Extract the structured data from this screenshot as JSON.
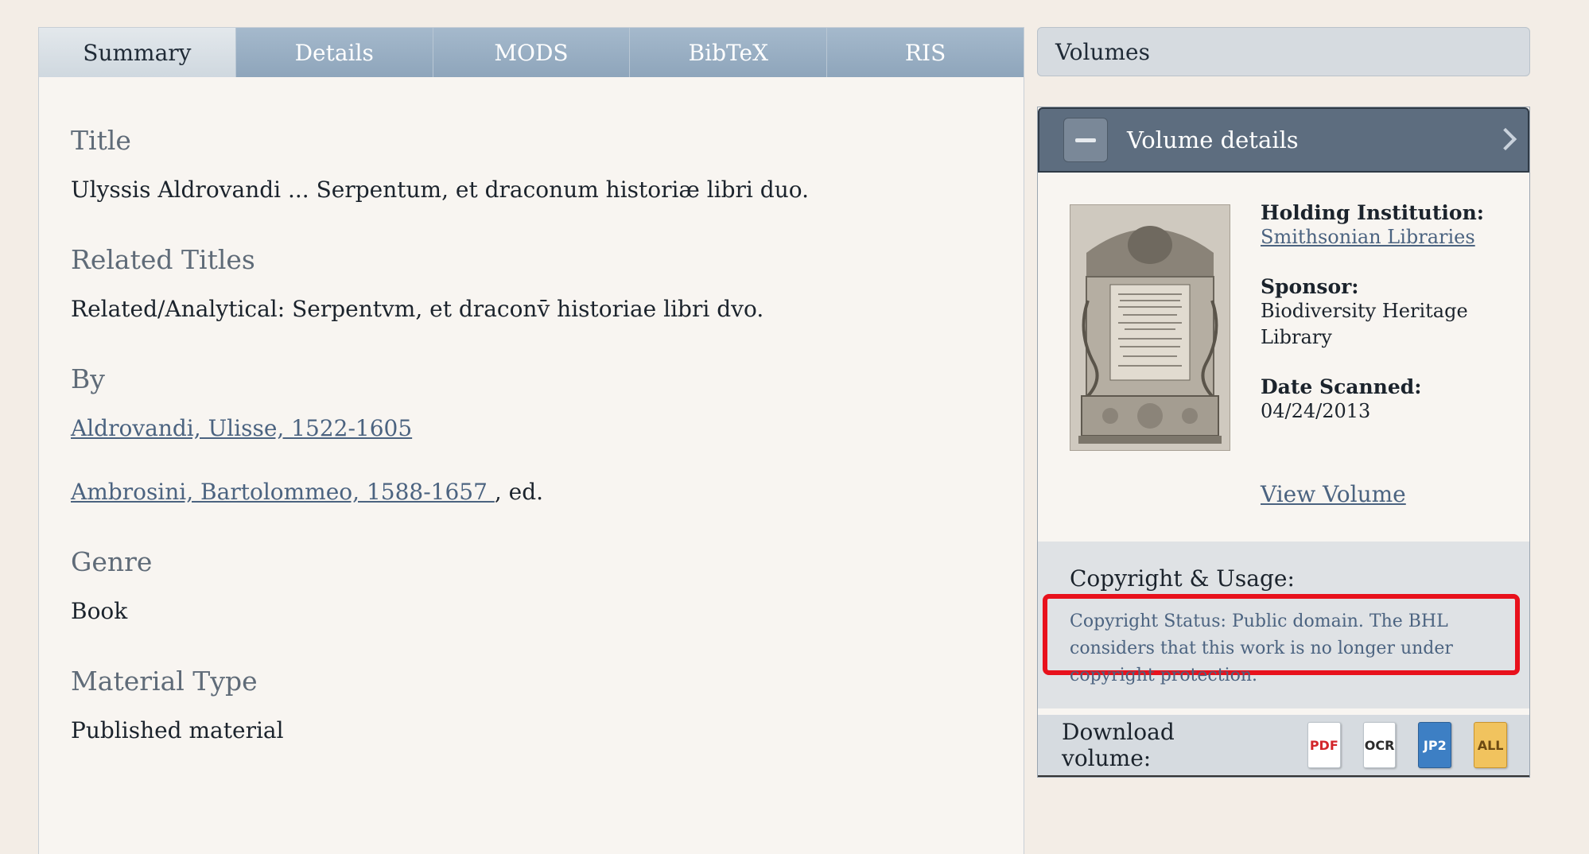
{
  "tabs": [
    {
      "label": "Summary",
      "active": true
    },
    {
      "label": "Details",
      "active": false
    },
    {
      "label": "MODS",
      "active": false
    },
    {
      "label": "BibTeX",
      "active": false
    },
    {
      "label": "RIS",
      "active": false
    }
  ],
  "summary": {
    "title_label": "Title",
    "title_value": "Ulyssis Aldrovandi ... Serpentum, et draconum historiæ libri duo.",
    "related_label": "Related Titles",
    "related_value": "Related/Analytical: Serpentvm, et draconv̄ historiae libri dvo.",
    "by_label": "By",
    "authors": [
      {
        "name": "Aldrovandi, Ulisse, 1522-1605 ",
        "suffix": ""
      },
      {
        "name": "Ambrosini, Bartolommeo, 1588-1657 ",
        "suffix": ", ed."
      }
    ],
    "genre_label": "Genre",
    "genre_value": "Book",
    "material_label": "Material Type",
    "material_value": "Published material"
  },
  "volumes": {
    "bar_label": "Volumes",
    "details_title": "Volume details",
    "holding_label": "Holding Institution:",
    "holding_value": "Smithsonian Libraries",
    "sponsor_label": "Sponsor:",
    "sponsor_value": "Biodiversity Heritage Library",
    "date_label": "Date Scanned:",
    "date_value": "04/24/2013",
    "view_volume": "View Volume",
    "copyright_label": "Copyright & Usage:",
    "copyright_text": "Copyright Status: Public domain. The BHL considers that this work is no longer under copyright protection.",
    "download_label": "Download volume:",
    "downloads": [
      "PDF",
      "OCR",
      "JP2",
      "ALL"
    ]
  },
  "colors": {
    "highlight": "#e8111c",
    "link": "#4b6380",
    "header": "#5d6d7f"
  }
}
